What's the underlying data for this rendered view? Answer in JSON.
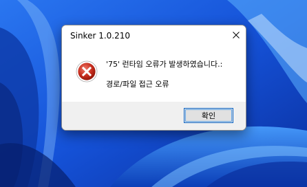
{
  "dialog": {
    "title": "Sinker 1.0.210",
    "message_line1": "'75' 런타임 오류가 발생하였습니다.:",
    "message_line2": "경로/파일 접근 오류",
    "ok_label": "확인",
    "icon": "error-icon"
  },
  "colors": {
    "wallpaper_base": "#1b63e6",
    "error_red": "#c42b1c",
    "button_focus": "#0a64c8"
  }
}
